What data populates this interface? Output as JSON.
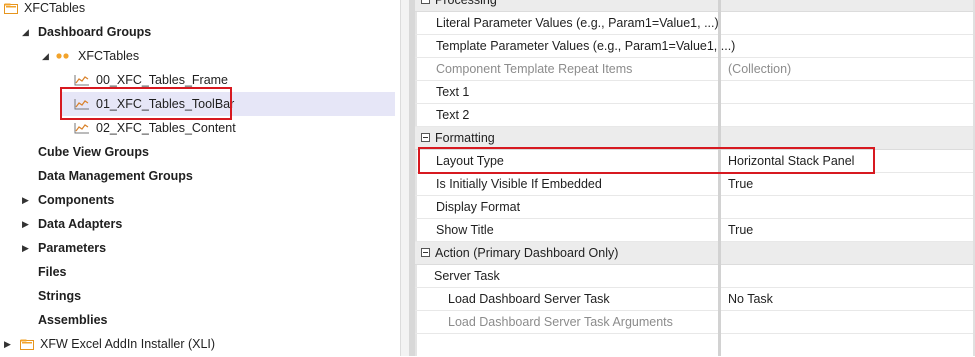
{
  "tree": {
    "root": "XFCTables",
    "dashboard_groups": "Dashboard Groups",
    "group": "XFCTables",
    "items": [
      "00_XFC_Tables_Frame",
      "01_XFC_Tables_ToolBar",
      "02_XFC_Tables_Content"
    ],
    "cube_view_groups": "Cube View Groups",
    "data_management_groups": "Data Management Groups",
    "components": "Components",
    "data_adapters": "Data Adapters",
    "parameters": "Parameters",
    "files": "Files",
    "strings": "Strings",
    "assemblies": "Assemblies",
    "xli": "XFW Excel AddIn Installer (XLI)"
  },
  "grid": {
    "cat_processing": "Processing",
    "literal_params": "Literal Parameter Values (e.g., Param1=Value1, ...)",
    "template_params": "Template Parameter Values (e.g., Param1=Value1, ...)",
    "template_repeat": "Component Template Repeat Items",
    "template_repeat_value": "(Collection)",
    "text1": "Text 1",
    "text2": "Text 2",
    "cat_formatting": "Formatting",
    "layout_type": "Layout Type",
    "layout_type_value": "Horizontal Stack Panel",
    "initially_visible": "Is Initially Visible If Embedded",
    "initially_visible_value": "True",
    "display_format": "Display Format",
    "show_title": "Show Title",
    "show_title_value": "True",
    "cat_action": "Action (Primary Dashboard Only)",
    "server_task": "Server Task",
    "load_task": "Load Dashboard Server Task",
    "load_task_value": "No Task",
    "load_task_args": "Load Dashboard Server Task Arguments"
  },
  "colors": {
    "highlight": "#d71920",
    "selection": "#e6e6f7",
    "folder": "#f2a32b",
    "category": "#ececec"
  }
}
